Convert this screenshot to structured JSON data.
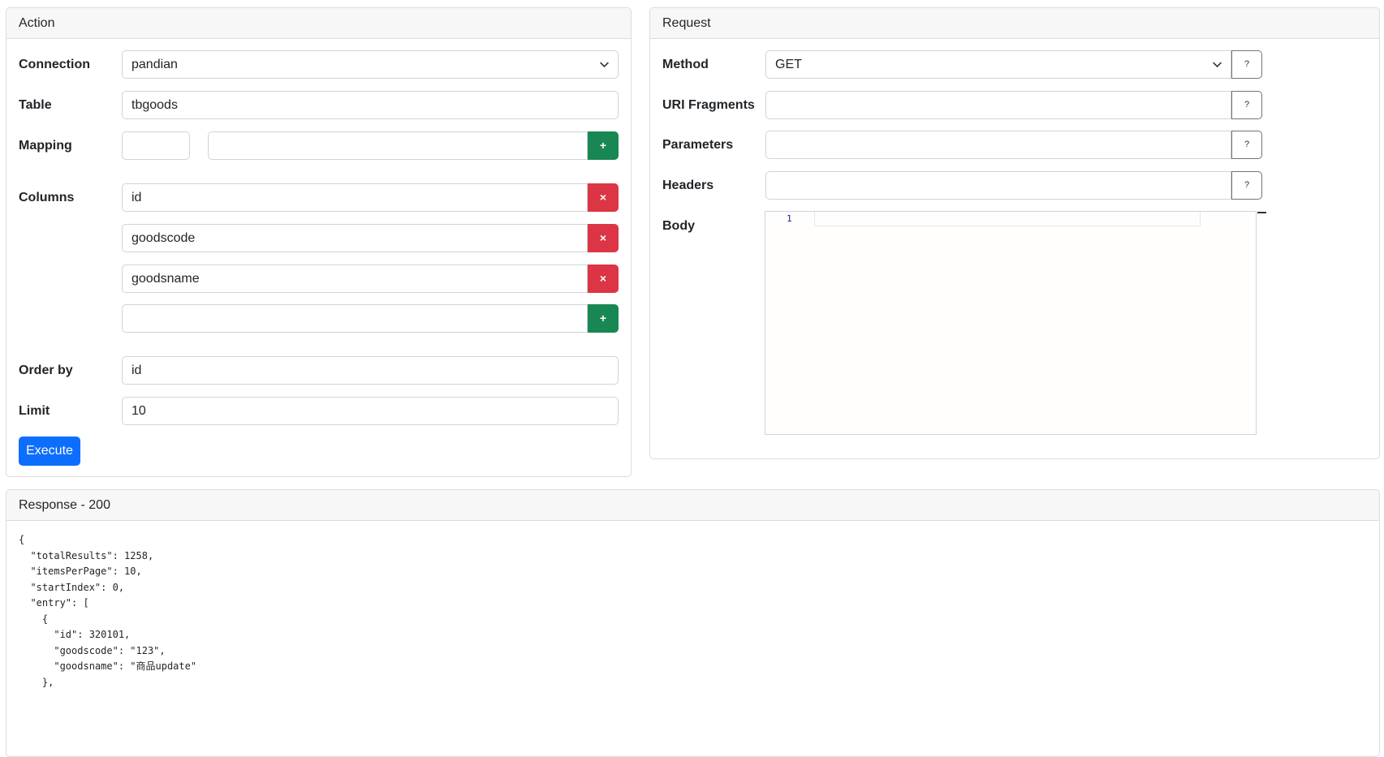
{
  "action": {
    "title": "Action",
    "connection": {
      "label": "Connection",
      "value": "pandian"
    },
    "table": {
      "label": "Table",
      "value": "tbgoods"
    },
    "mapping": {
      "label": "Mapping",
      "key_value": "",
      "value_value": "",
      "add_symbol": "+"
    },
    "columns": {
      "label": "Columns",
      "items": [
        "id",
        "goodscode",
        "goodsname"
      ],
      "remove_symbol": "×",
      "new_value": "",
      "add_symbol": "+"
    },
    "order_by": {
      "label": "Order by",
      "value": "id"
    },
    "limit": {
      "label": "Limit",
      "value": "10"
    },
    "execute_label": "Execute"
  },
  "request": {
    "title": "Request",
    "method": {
      "label": "Method",
      "value": "GET"
    },
    "uri_fragments": {
      "label": "URI Fragments",
      "value": ""
    },
    "parameters": {
      "label": "Parameters",
      "value": ""
    },
    "headers": {
      "label": "Headers",
      "value": ""
    },
    "body": {
      "label": "Body",
      "line_number": "1"
    },
    "help_symbol": "?"
  },
  "response": {
    "title": "Response - 200",
    "body": "{\n  \"totalResults\": 1258,\n  \"itemsPerPage\": 10,\n  \"startIndex\": 0,\n  \"entry\": [\n    {\n      \"id\": 320101,\n      \"goodscode\": \"123\",\n      \"goodsname\": \"商品update\"\n    },"
  },
  "colors": {
    "primary": "#0d6efd",
    "success": "#198754",
    "danger": "#dc3545",
    "border": "#ced4da",
    "header_bg": "#f7f7f7"
  }
}
